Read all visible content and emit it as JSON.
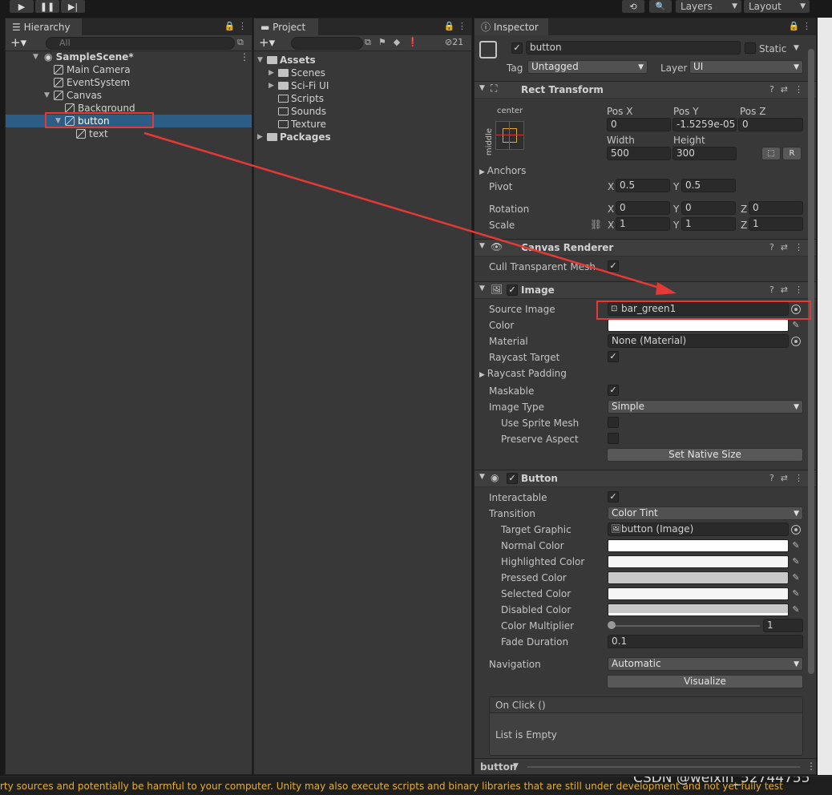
{
  "toolbar": {
    "play": "▶",
    "pause": "❚❚",
    "step": "▶|",
    "history": "⟲",
    "search": "🔍",
    "layers": "Layers",
    "layout": "Layout"
  },
  "hierarchy": {
    "tab": "Hierarchy",
    "search_placeholder": "All",
    "items": [
      {
        "label": "SampleScene*",
        "bold": true
      },
      {
        "label": "Main Camera"
      },
      {
        "label": "EventSystem"
      },
      {
        "label": "Canvas"
      },
      {
        "label": "Background"
      },
      {
        "label": "button"
      },
      {
        "label": "text"
      }
    ]
  },
  "project": {
    "tab": "Project",
    "count": "21",
    "items": [
      {
        "label": "Assets"
      },
      {
        "label": "Scenes"
      },
      {
        "label": "Sci-Fi UI"
      },
      {
        "label": "Scripts"
      },
      {
        "label": "Sounds"
      },
      {
        "label": "Texture"
      },
      {
        "label": "Packages"
      }
    ]
  },
  "inspector": {
    "tab": "Inspector",
    "object_name": "button",
    "static_label": "Static",
    "tag_label": "Tag",
    "tag_value": "Untagged",
    "layer_label": "Layer",
    "layer_value": "UI",
    "rect": {
      "title": "Rect Transform",
      "anchor_h": "center",
      "anchor_v": "middle",
      "posx_label": "Pos X",
      "posy_label": "Pos Y",
      "posz_label": "Pos Z",
      "posx": "0",
      "posy": "-1.5259e-05",
      "posz": "0",
      "width_label": "Width",
      "height_label": "Height",
      "width": "500",
      "height": "300",
      "r_btn": "R",
      "anchors": "Anchors",
      "pivot": "Pivot",
      "pivot_x": "0.5",
      "pivot_y": "0.5",
      "rotation": "Rotation",
      "rot_x": "0",
      "rot_y": "0",
      "rot_z": "0",
      "scale": "Scale",
      "scale_x": "1",
      "scale_y": "1",
      "scale_z": "1",
      "x": "X",
      "y": "Y",
      "z": "Z"
    },
    "canvas_renderer": {
      "title": "Canvas Renderer",
      "cull": "Cull Transparent Mesh"
    },
    "image": {
      "title": "Image",
      "source_label": "Source Image",
      "source_value": "bar_green1",
      "color": "Color",
      "material": "Material",
      "material_value": "None (Material)",
      "raycast_target": "Raycast Target",
      "raycast_padding": "Raycast Padding",
      "maskable": "Maskable",
      "image_type": "Image Type",
      "image_type_value": "Simple",
      "use_sprite_mesh": "Use Sprite Mesh",
      "preserve_aspect": "Preserve Aspect",
      "set_native": "Set Native Size"
    },
    "button": {
      "title": "Button",
      "interactable": "Interactable",
      "transition": "Transition",
      "transition_value": "Color Tint",
      "target_graphic": "Target Graphic",
      "target_graphic_value": "button (Image)",
      "normal": "Normal Color",
      "highlighted": "Highlighted Color",
      "pressed": "Pressed Color",
      "selected": "Selected Color",
      "disabled": "Disabled Color",
      "multiplier": "Color Multiplier",
      "multiplier_value": "1",
      "fade": "Fade Duration",
      "fade_value": "0.1",
      "navigation": "Navigation",
      "navigation_value": "Automatic",
      "visualize": "Visualize",
      "onclick": "On Click ()",
      "list_empty": "List is Empty"
    },
    "footer_name": "button"
  },
  "status_text": "rty sources and potentially be harmful to your computer. Unity may also execute scripts and binary libraries that are still under development and not yet fully test",
  "watermark": "CSDN @weixin_52744755",
  "colors": {
    "accent_red": "#e53935",
    "selection": "#2c5d87",
    "status_yellow": "#e5b02b"
  }
}
